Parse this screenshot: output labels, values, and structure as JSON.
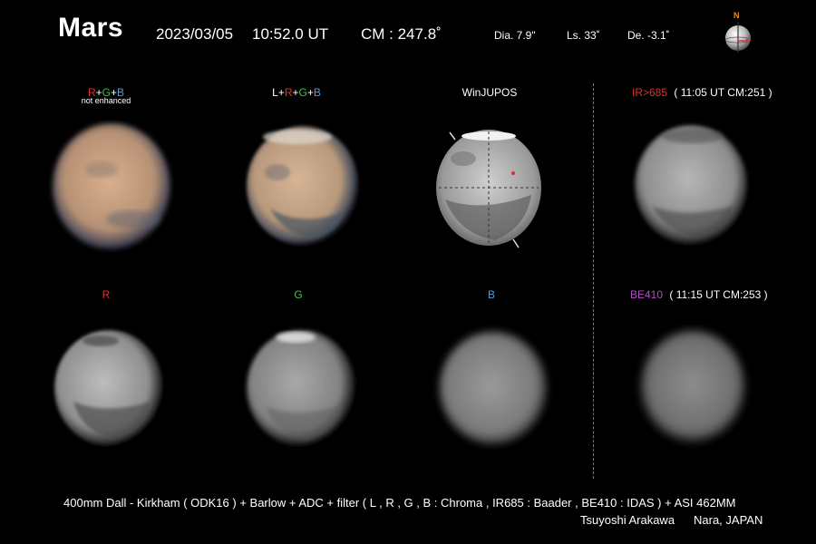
{
  "header": {
    "title": "Mars",
    "date": "2023/03/05",
    "time": "10:52.0 UT",
    "cm": "CM : 247.8˚",
    "dia": "Dia. 7.9\"",
    "ls": "Ls. 33˚",
    "de": "De. -3.1˚",
    "compass_n": "N"
  },
  "top_row": {
    "rgb_label": [
      {
        "text": "R",
        "color": "#e0302a"
      },
      {
        "text": "+",
        "color": "#ffffff"
      },
      {
        "text": "G",
        "color": "#3fc23f"
      },
      {
        "text": "+",
        "color": "#ffffff"
      },
      {
        "text": "B",
        "color": "#4aa0e0"
      }
    ],
    "rgb_sub": "not enhanced",
    "lrgb_label": [
      {
        "text": "L",
        "color": "#ffffff"
      },
      {
        "text": "+",
        "color": "#ffffff"
      },
      {
        "text": "R",
        "color": "#e0302a"
      },
      {
        "text": "+",
        "color": "#ffffff"
      },
      {
        "text": "G",
        "color": "#3fc23f"
      },
      {
        "text": "+",
        "color": "#ffffff"
      },
      {
        "text": "B",
        "color": "#4aa0e0"
      }
    ],
    "winjupos_label": "WinJUPOS",
    "ir_label": "IR>685",
    "ir_info": "( 11:05 UT  CM:251 )"
  },
  "bottom_row": {
    "r_label": "R",
    "g_label": "G",
    "b_label": "B",
    "be_label": "BE410",
    "be_info": "( 11:15 UT  CM:253 )"
  },
  "colors": {
    "red": "#e0302a",
    "green": "#3fc23f",
    "blue": "#4aa0e0",
    "purple": "#b04fc4"
  },
  "footer": {
    "equipment": "400mm Dall - Kirkham  ( ODK16 ) +  Barlow  +  ADC  +  filter (  L , R , G , B : Chroma   ,  IR685 : Baader  ,  BE410 : IDAS  ) +  ASI 462MM",
    "observer": "Tsuyoshi   Arakawa",
    "location": "Nara, JAPAN"
  }
}
